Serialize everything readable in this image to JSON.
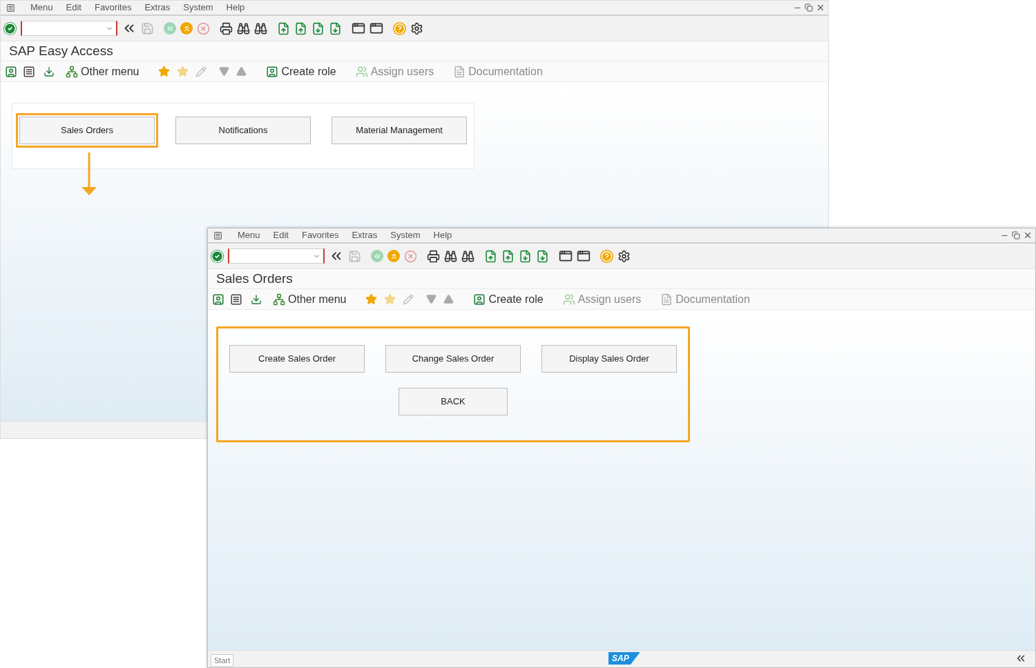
{
  "windows": [
    {
      "menu": [
        {
          "label": "Menu"
        },
        {
          "label": "Edit"
        },
        {
          "label": "Favorites"
        },
        {
          "label": "Extras"
        },
        {
          "label": "System"
        },
        {
          "label": "Help"
        }
      ],
      "title": "SAP Easy Access",
      "toolbar": [
        {
          "kind": "other",
          "label": "Other menu",
          "disabled": false
        },
        {
          "kind": "role",
          "label": "Create role",
          "disabled": false
        },
        {
          "kind": "users",
          "label": "Assign users",
          "disabled": true
        },
        {
          "kind": "doc",
          "label": "Documentation",
          "disabled": true
        }
      ],
      "panel": {
        "highlighted": false,
        "tiles": [
          {
            "label": "Sales Orders",
            "highlighted": true
          },
          {
            "label": "Notifications",
            "highlighted": false
          },
          {
            "label": "Material Management",
            "highlighted": false
          }
        ]
      }
    },
    {
      "menu": [
        {
          "label": "Menu"
        },
        {
          "label": "Edit"
        },
        {
          "label": "Favorites"
        },
        {
          "label": "Extras"
        },
        {
          "label": "System"
        },
        {
          "label": "Help"
        }
      ],
      "title": "Sales Orders",
      "toolbar": [
        {
          "kind": "other",
          "label": "Other menu",
          "disabled": false
        },
        {
          "kind": "role",
          "label": "Create role",
          "disabled": false
        },
        {
          "kind": "users",
          "label": "Assign users",
          "disabled": true
        },
        {
          "kind": "doc",
          "label": "Documentation",
          "disabled": true
        }
      ],
      "panel": {
        "highlighted": true,
        "tiles": [
          {
            "label": "Create Sales Order",
            "highlighted": false
          },
          {
            "label": "Change Sales Order",
            "highlighted": false
          },
          {
            "label": "Display Sales Order",
            "highlighted": false
          }
        ],
        "back_button": "BACK"
      },
      "status": {
        "start": "Start",
        "logo": "SAP"
      }
    }
  ]
}
